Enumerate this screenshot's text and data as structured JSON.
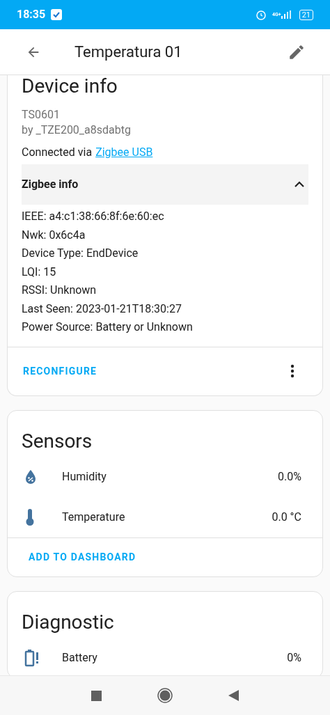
{
  "status_bar": {
    "time": "18:35",
    "network": "4G+",
    "battery": "21"
  },
  "app_bar": {
    "title": "Temperatura 01"
  },
  "device_info": {
    "title": "Device info",
    "model": "TS0601",
    "manufacturer": "by _TZE200_a8sdabtg",
    "connected_via": "Connected via",
    "connection_link": "Zigbee USB",
    "zigbee_info": {
      "title": "Zigbee info",
      "expanded": true,
      "lines": [
        "IEEE: a4:c1:38:66:8f:6e:60:ec",
        "Nwk: 0x6c4a",
        "Device Type: EndDevice",
        "LQI: 15",
        "RSSI: Unknown",
        "Last Seen: 2023-01-21T18:30:27",
        "Power Source: Battery or Unknown"
      ]
    },
    "action": "RECONFIGURE"
  },
  "sensors": {
    "title": "Sensors",
    "entities": [
      {
        "kind": "humidity",
        "name": "Humidity",
        "value": "0.0%"
      },
      {
        "kind": "temperature",
        "name": "Temperature",
        "value": "0.0 °C"
      }
    ],
    "action": "ADD TO DASHBOARD"
  },
  "diagnostic": {
    "title": "Diagnostic",
    "entities": [
      {
        "kind": "battery",
        "name": "Battery",
        "value": "0%"
      }
    ]
  }
}
